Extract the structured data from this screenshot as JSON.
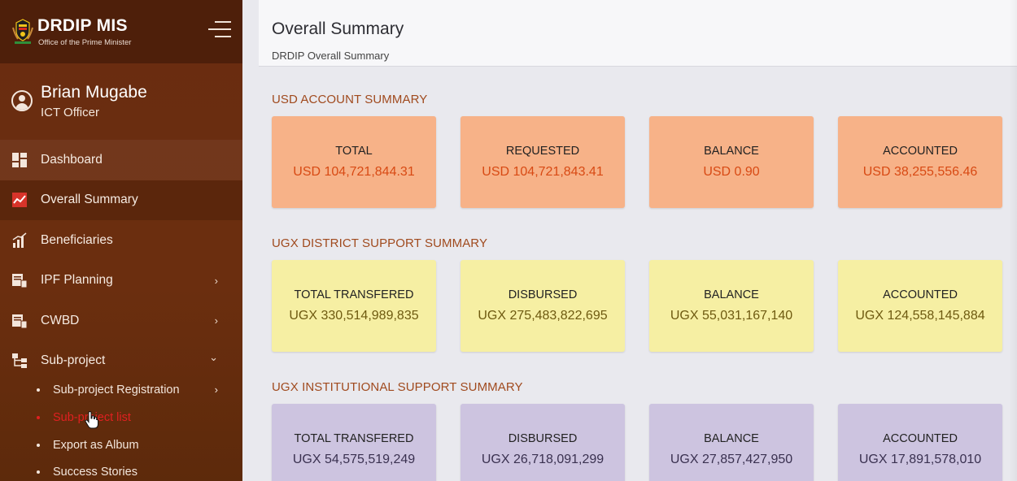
{
  "brand": {
    "title": "DRDIP MIS",
    "subtitle": "Office of the Prime Minister"
  },
  "user": {
    "name": "Brian Mugabe",
    "role": "ICT Officer"
  },
  "nav": {
    "dashboard": "Dashboard",
    "overall_summary": "Overall Summary",
    "beneficiaries": "Beneficiaries",
    "ipf_planning": "IPF Planning",
    "cwbd": "CWBD",
    "sub_project": "Sub-project",
    "chevron_right": "›",
    "chevron_down": "⌄"
  },
  "sub_nav": {
    "registration": "Sub-project Registration",
    "list": "Sub-project list",
    "album": "Export as Album",
    "stories": "Success Stories"
  },
  "header": {
    "title": "Overall Summary",
    "subtitle": "DRDIP Overall Summary"
  },
  "sections": {
    "usd": {
      "title": "USD ACCOUNT SUMMARY",
      "cards": [
        {
          "label": "TOTAL",
          "value": "USD 104,721,844.31"
        },
        {
          "label": "REQUESTED",
          "value": "USD 104,721,843.41"
        },
        {
          "label": "BALANCE",
          "value": "USD 0.90"
        },
        {
          "label": "ACCOUNTED",
          "value": "USD 38,255,556.46"
        }
      ]
    },
    "ugx_district": {
      "title": "UGX DISTRICT SUPPORT SUMMARY",
      "cards": [
        {
          "label": "TOTAL TRANSFERED",
          "value": "UGX 330,514,989,835"
        },
        {
          "label": "DISBURSED",
          "value": "UGX 275,483,822,695"
        },
        {
          "label": "BALANCE",
          "value": "UGX 55,031,167,140"
        },
        {
          "label": "ACCOUNTED",
          "value": "UGX 124,558,145,884"
        }
      ]
    },
    "ugx_institutional": {
      "title": "UGX INSTITUTIONAL SUPPORT SUMMARY",
      "cards": [
        {
          "label": "TOTAL TRANSFERED",
          "value": "UGX 54,575,519,249"
        },
        {
          "label": "DISBURSED",
          "value": "UGX 26,718,091,299"
        },
        {
          "label": "BALANCE",
          "value": "UGX 27,857,427,950"
        },
        {
          "label": "ACCOUNTED",
          "value": "UGX 17,891,578,010"
        }
      ]
    }
  },
  "colors": {
    "sidebar": "#6a2c10",
    "usd_card": "#f7b288",
    "ugx_district_card": "#f6efa3",
    "ugx_institutional_card": "#cdc4e0",
    "section_title": "#a04a1e",
    "active_link": "#e02020"
  }
}
